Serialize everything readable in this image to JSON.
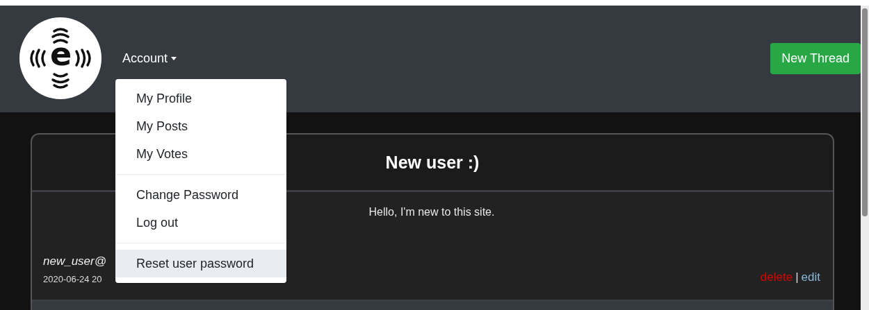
{
  "navbar": {
    "logo_letter": "e",
    "account_menu": {
      "label": "Account",
      "expanded": true,
      "groups": [
        [
          {
            "label": "My Profile",
            "hovered": false
          },
          {
            "label": "My Posts",
            "hovered": false
          },
          {
            "label": "My Votes",
            "hovered": false
          }
        ],
        [
          {
            "label": "Change Password",
            "hovered": false
          },
          {
            "label": "Log out",
            "hovered": false
          }
        ],
        [
          {
            "label": "Reset user password",
            "hovered": true
          }
        ]
      ]
    },
    "new_thread_button": "New Thread"
  },
  "thread": {
    "title": "New user :)",
    "post": {
      "body": "Hello, I'm new to this site.",
      "author": "new_user@",
      "date": "2020-06-24 20",
      "delete_link": "delete",
      "separator": "|",
      "edit_link": "edit"
    }
  }
}
